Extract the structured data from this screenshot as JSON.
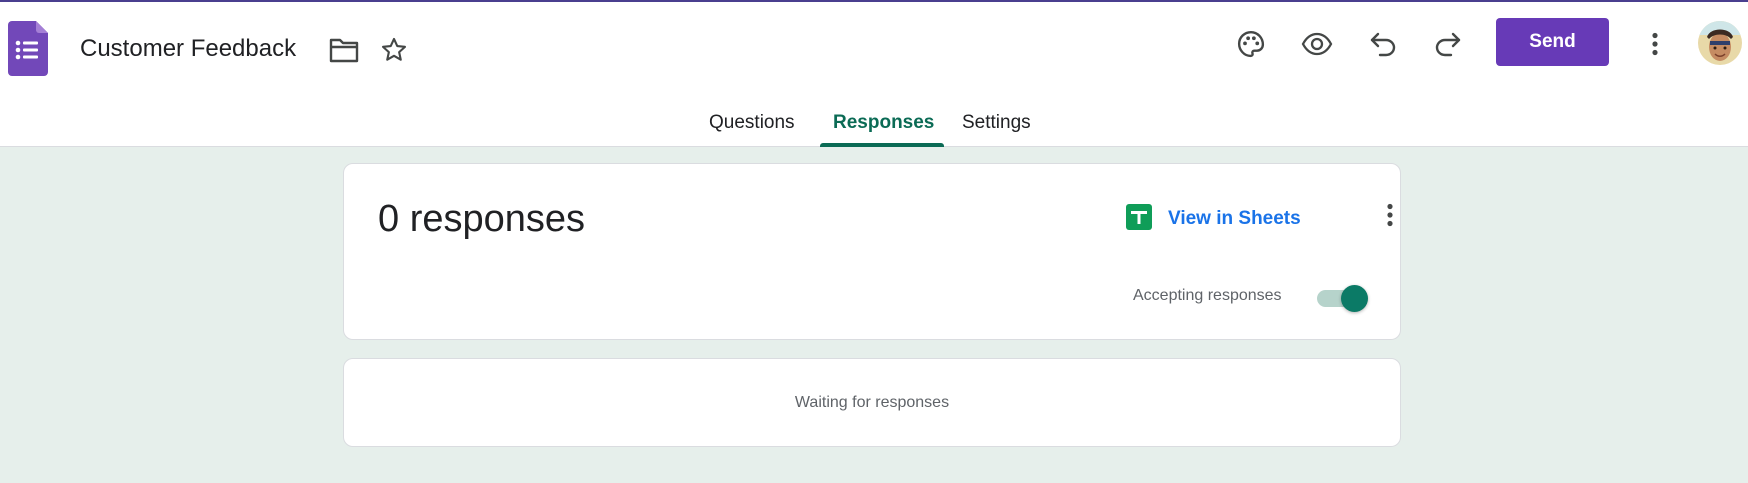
{
  "header": {
    "title": "Customer Feedback",
    "send_label": "Send"
  },
  "icons": {
    "app": "google-forms-icon",
    "folder": "folder-icon",
    "star": "star-icon",
    "palette": "palette-icon",
    "preview": "eye-icon",
    "undo": "undo-icon",
    "redo": "redo-icon",
    "more": "more-vert-icon",
    "sheets": "google-sheets-icon"
  },
  "tabs": [
    {
      "label": "Questions",
      "active": false
    },
    {
      "label": "Responses",
      "active": true
    },
    {
      "label": "Settings",
      "active": false
    }
  ],
  "summary": {
    "count_text": "0 responses",
    "sheets_link": "View in Sheets",
    "accepting_label": "Accepting responses",
    "accepting": true
  },
  "empty_state": {
    "text": "Waiting for responses"
  },
  "colors": {
    "brand": "#673ab7",
    "accent": "#0b6b55",
    "link": "#1a73e8",
    "page_bg": "#e6efeb",
    "sheets_green": "#0f9d58"
  }
}
